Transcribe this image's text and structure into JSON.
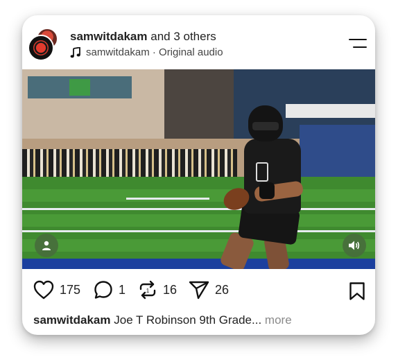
{
  "post": {
    "header": {
      "username": "samwitdakam",
      "coauthors": "and 3 others",
      "audio_icon": "music-note-icon",
      "audio_label": "samwitdakam · Original audio",
      "menu_icon": "hamburger-menu-icon"
    },
    "media": {
      "description_icons": [
        "user-icon",
        "speaker-icon"
      ]
    },
    "actions": {
      "likes": "175",
      "comments": "1",
      "reposts": "16",
      "shares": "26"
    },
    "caption": {
      "username": "samwitdakam",
      "text": "Joe T Robinson 9th Grade...",
      "more": "more"
    }
  }
}
